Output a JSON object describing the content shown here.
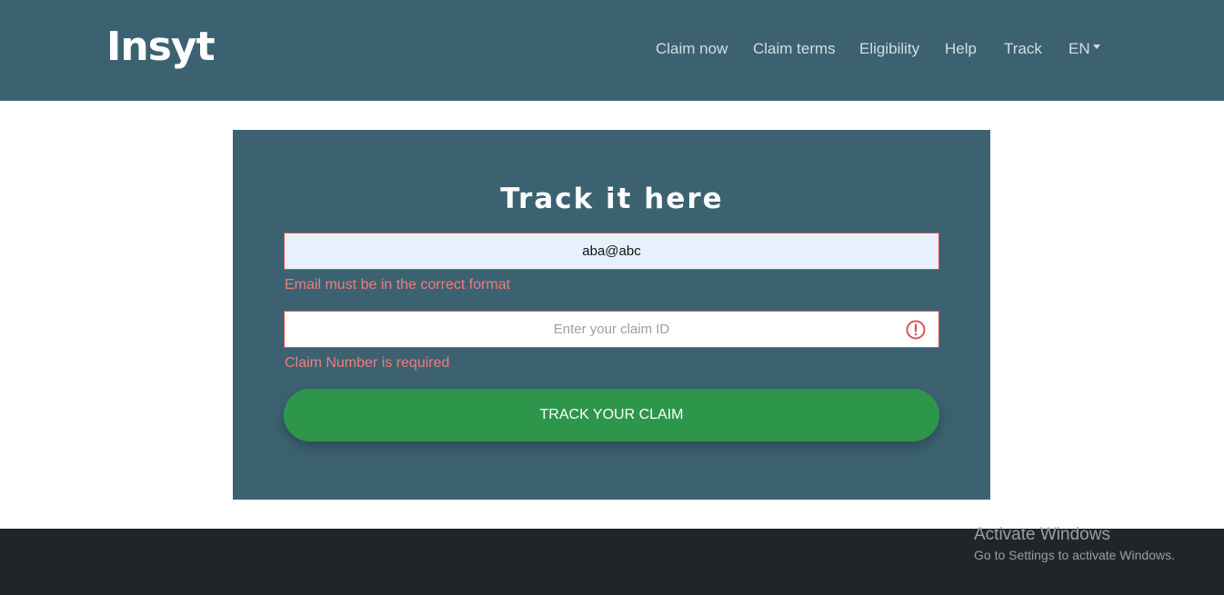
{
  "header": {
    "logo_text": "Insyt",
    "nav": {
      "claim_now": "Claim now",
      "claim_terms": "Claim terms",
      "eligibility": "Eligibility",
      "help": "Help",
      "track": "Track",
      "language": "EN"
    }
  },
  "form": {
    "title": "Track it here",
    "email_value": "aba@abc",
    "email_error": "Email must be in the correct format",
    "claim_placeholder": "Enter your claim ID",
    "claim_error": "Claim Number is required",
    "submit_label": "TRACK YOUR CLAIM",
    "claim_error_icon": "exclamation-circle-icon"
  },
  "windows_watermark": {
    "line1": "Activate Windows",
    "line2": "Go to Settings to activate Windows."
  },
  "colors": {
    "header_bg": "#3c6272",
    "card_bg": "#3c6272",
    "button_bg": "#2e964a",
    "error": "#f07c7c",
    "footer_bg": "#212428"
  }
}
